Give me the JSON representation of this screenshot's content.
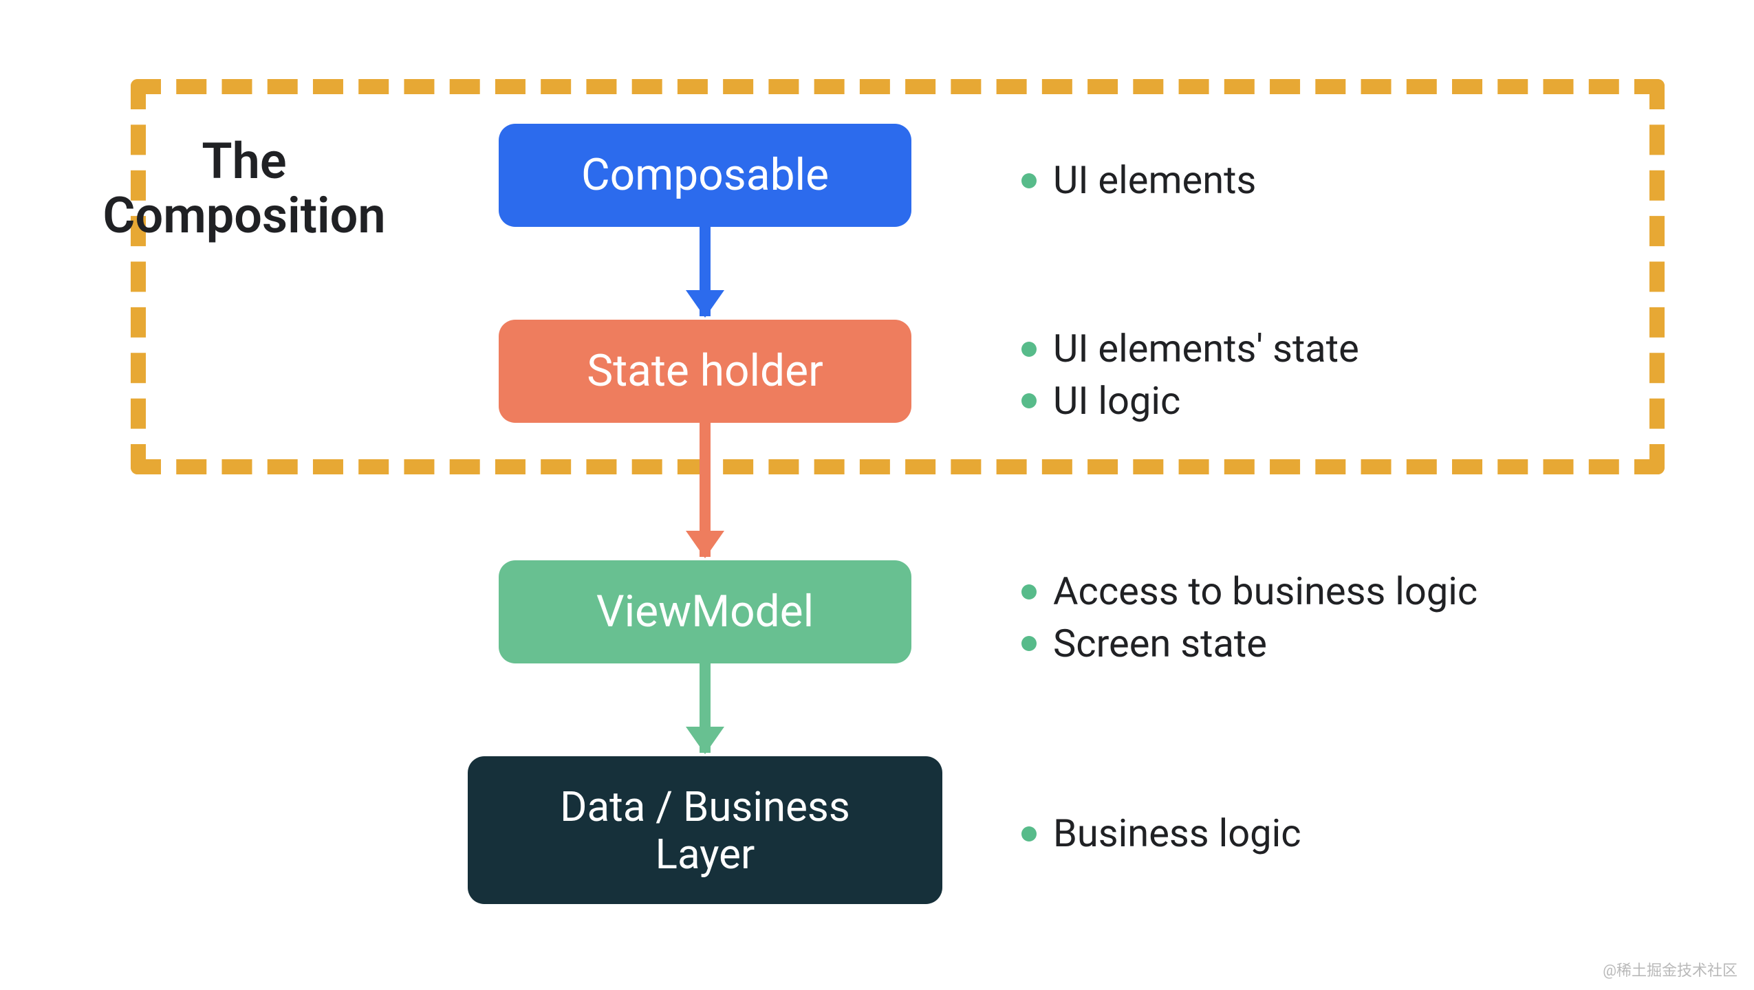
{
  "region_label_line1": "The",
  "region_label_line2": "Composition",
  "blocks": {
    "composable": {
      "label": "Composable",
      "color": "blue"
    },
    "state_holder": {
      "label": "State holder",
      "color": "orange"
    },
    "viewmodel": {
      "label": "ViewModel",
      "color": "green"
    },
    "data_layer": {
      "label": "Data / Business\nLayer",
      "color": "dark"
    }
  },
  "bullets": {
    "composable": [
      "UI elements"
    ],
    "state_holder": [
      "UI elements' state",
      "UI logic"
    ],
    "viewmodel": [
      "Access to business logic",
      "Screen state"
    ],
    "data_layer": [
      "Business logic"
    ]
  },
  "arrows": [
    {
      "from": "composable",
      "to": "state_holder",
      "color": "blue"
    },
    {
      "from": "state_holder",
      "to": "viewmodel",
      "color": "orange"
    },
    {
      "from": "viewmodel",
      "to": "data_layer",
      "color": "green"
    }
  ],
  "colors": {
    "blue": "#2c6bed",
    "orange": "#ee7d5e",
    "green": "#68c091",
    "dark": "#16303a",
    "dash": "#e7a834",
    "bullet": "#57bb8a"
  },
  "watermark": "@稀土掘金技术社区"
}
